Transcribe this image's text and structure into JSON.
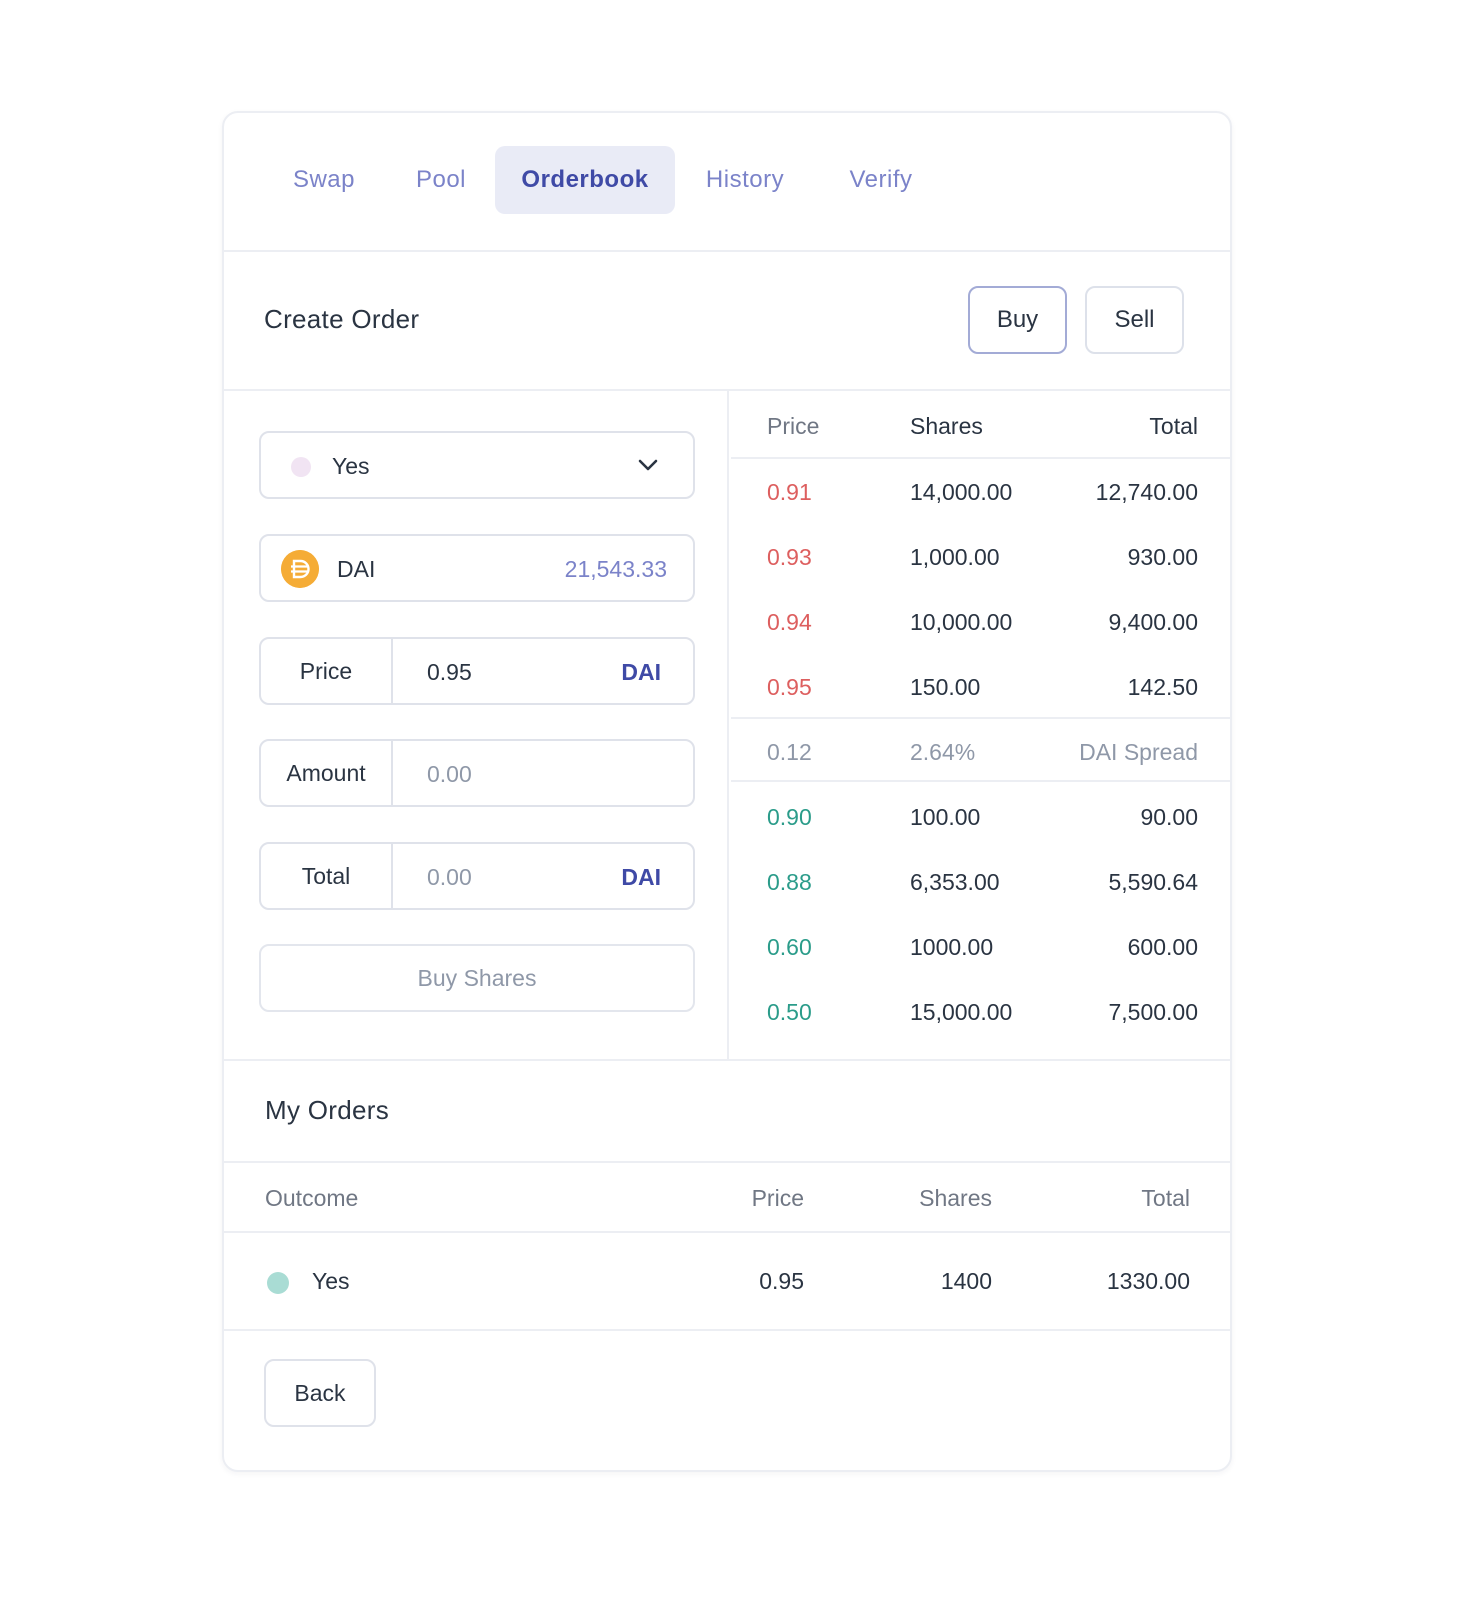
{
  "tabs": [
    {
      "label": "Swap"
    },
    {
      "label": "Pool"
    },
    {
      "label": "Orderbook",
      "active": true
    },
    {
      "label": "History"
    },
    {
      "label": "Verify"
    }
  ],
  "create_order": {
    "title": "Create Order",
    "buy_label": "Buy",
    "sell_label": "Sell",
    "selected_mode": "Buy"
  },
  "form": {
    "outcome": {
      "value": "Yes",
      "icon": "chevron-down-icon"
    },
    "token": {
      "symbol": "DAI",
      "balance": "21,543.33",
      "icon": "dai-coin-icon"
    },
    "price": {
      "label": "Price",
      "value": "0.95",
      "unit": "DAI"
    },
    "amount": {
      "label": "Amount",
      "placeholder": "0.00"
    },
    "total": {
      "label": "Total",
      "placeholder": "0.00",
      "unit": "DAI"
    },
    "submit_label": "Buy Shares"
  },
  "orderbook": {
    "headers": {
      "price": "Price",
      "shares": "Shares",
      "total": "Total"
    },
    "asks": [
      {
        "price": "0.91",
        "shares": "14,000.00",
        "total": "12,740.00"
      },
      {
        "price": "0.93",
        "shares": "1,000.00",
        "total": "930.00"
      },
      {
        "price": "0.94",
        "shares": "10,000.00",
        "total": "9,400.00"
      },
      {
        "price": "0.95",
        "shares": "150.00",
        "total": "142.50"
      }
    ],
    "spread": {
      "value": "0.12",
      "percent": "2.64%",
      "label": "DAI Spread"
    },
    "bids": [
      {
        "price": "0.90",
        "shares": "100.00",
        "total": "90.00"
      },
      {
        "price": "0.88",
        "shares": "6,353.00",
        "total": "5,590.64"
      },
      {
        "price": "0.60",
        "shares": "1000.00",
        "total": "600.00"
      },
      {
        "price": "0.50",
        "shares": "15,000.00",
        "total": "7,500.00"
      }
    ],
    "colors": {
      "ask": "#dd5f5f",
      "bid": "#2b9c8a"
    }
  },
  "my_orders": {
    "title": "My Orders",
    "headers": {
      "outcome": "Outcome",
      "price": "Price",
      "shares": "Shares",
      "total": "Total"
    },
    "rows": [
      {
        "outcome": "Yes",
        "price": "0.95",
        "shares": "1400",
        "total": "1330.00"
      }
    ]
  },
  "back_label": "Back",
  "colors": {
    "accent": "#3f4aa6",
    "accent_light": "#7b83c9",
    "border": "#eceef3"
  }
}
